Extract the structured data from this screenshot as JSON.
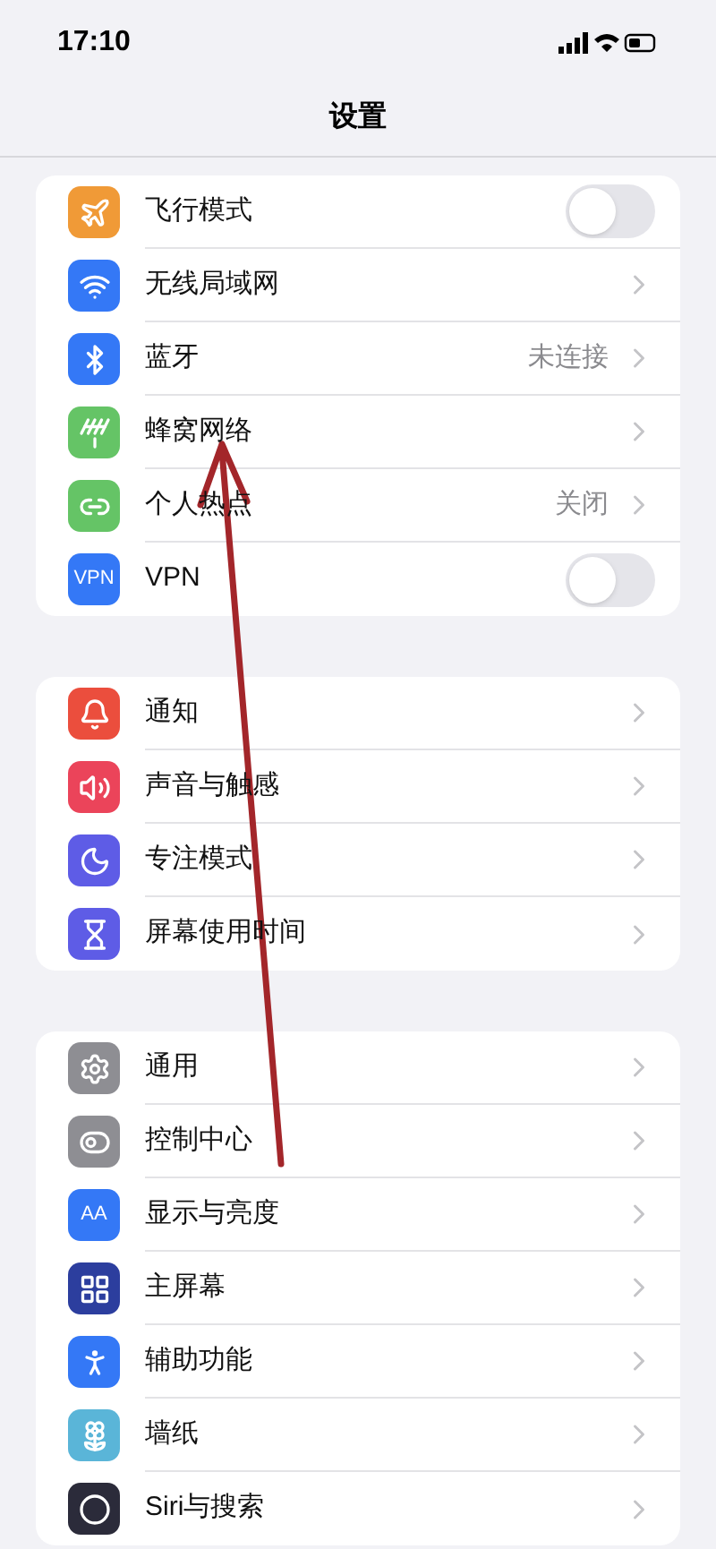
{
  "status_bar": {
    "time": "17:10"
  },
  "title": "设置",
  "groups": [
    {
      "items": [
        {
          "kind": "toggle",
          "label": "飞行模式",
          "color": "#f09a37",
          "on": false
        },
        {
          "kind": "link",
          "label": "无线局域网",
          "color": "#3478f6"
        },
        {
          "kind": "link",
          "label": "蓝牙",
          "color": "#3478f6",
          "value": "未连接"
        },
        {
          "kind": "link",
          "label": "蜂窝网络",
          "color": "#65c466"
        },
        {
          "kind": "link",
          "label": "个人热点",
          "color": "#65c466",
          "value": "关闭"
        },
        {
          "kind": "toggle",
          "label": "VPN",
          "color": "#3478f6",
          "icon_text": "VPN",
          "on": false
        }
      ]
    },
    {
      "items": [
        {
          "kind": "link",
          "label": "通知",
          "color": "#eb4e3d"
        },
        {
          "kind": "link",
          "label": "声音与触感",
          "color": "#eb445a"
        },
        {
          "kind": "link",
          "label": "专注模式",
          "color": "#5e5ce6"
        },
        {
          "kind": "link",
          "label": "屏幕使用时间",
          "color": "#5e5ce6"
        }
      ]
    },
    {
      "items": [
        {
          "kind": "link",
          "label": "通用",
          "color": "#8e8e93"
        },
        {
          "kind": "link",
          "label": "控制中心",
          "color": "#8e8e93"
        },
        {
          "kind": "link",
          "label": "显示与亮度",
          "color": "#3478f6",
          "icon_text": "AA"
        },
        {
          "kind": "link",
          "label": "主屏幕",
          "color": "#2c3e9e"
        },
        {
          "kind": "link",
          "label": "辅助功能",
          "color": "#3478f6"
        },
        {
          "kind": "link",
          "label": "墙纸",
          "color": "#5ab5d8"
        },
        {
          "kind": "link",
          "label": "Siri与搜索",
          "color": "#2b2b3a"
        }
      ]
    }
  ]
}
